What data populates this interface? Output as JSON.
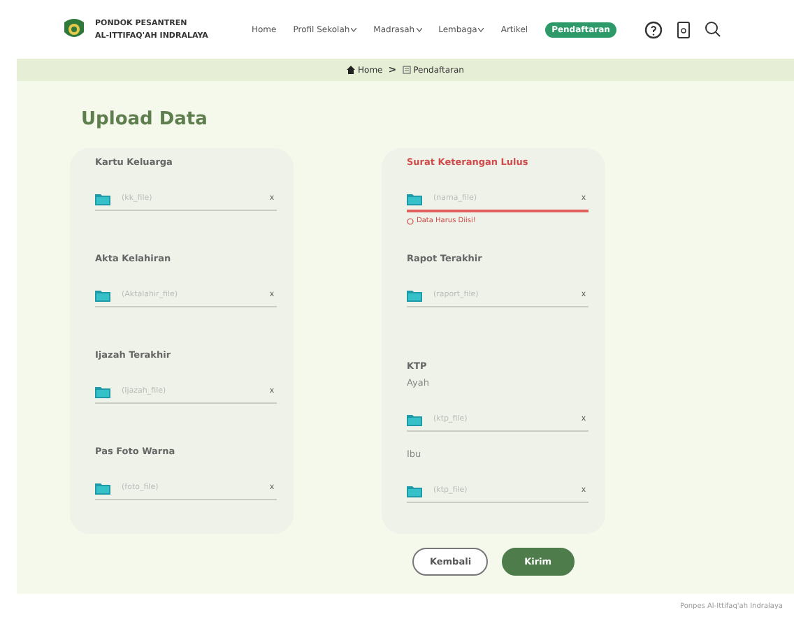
{
  "brand": {
    "line_1": "PONDOK PESANTREN",
    "line_2": "AL-ITTIFAQ'AH INDRALAYA"
  },
  "nav": [
    {
      "label": "Home",
      "has_menu": false,
      "selected": false
    },
    {
      "label": "Profil Sekolah",
      "has_menu": true,
      "selected": false
    },
    {
      "label": "Madrasah",
      "has_menu": true,
      "selected": false
    },
    {
      "label": "Lembaga",
      "has_menu": true,
      "selected": false
    },
    {
      "label": "Artikel",
      "has_menu": false,
      "selected": false
    },
    {
      "label": "Pendaftaran",
      "has_menu": false,
      "selected": true
    }
  ],
  "breadcrumb": [
    {
      "label": "Home",
      "kind": "home"
    },
    {
      "label": "Pendaftaran",
      "kind": "page"
    }
  ],
  "breadcrumb_separator": ">",
  "title": "Upload Data",
  "columns": [
    [
      {
        "kind": "upload",
        "label": "Kartu Keluarga",
        "placeholder": "(kk_file)",
        "clear": "x",
        "invalid": false
      },
      {
        "kind": "upload",
        "label": "Akta Kelahiran",
        "placeholder": "(Aktalahir_file)",
        "clear": "x",
        "invalid": false
      },
      {
        "kind": "upload",
        "label": "Ijazah Terakhir",
        "placeholder": "(Ijazah_file)",
        "clear": "x",
        "invalid": false
      },
      {
        "kind": "upload",
        "label": "Pas Foto Warna",
        "placeholder": "(foto_file)",
        "clear": "x",
        "invalid": false
      }
    ],
    [
      {
        "kind": "upload",
        "label": "Surat Keterangan Lulus",
        "placeholder": "(nama_file)",
        "clear": "x",
        "invalid": true,
        "error": "Data Harus Diisi!"
      },
      {
        "kind": "upload",
        "label": "Rapot Terakhir",
        "placeholder": "(raport_file)",
        "clear": "x",
        "invalid": false
      },
      {
        "kind": "group",
        "label": "KTP",
        "children": [
          {
            "kind": "upload",
            "label": "Ayah",
            "placeholder": "(ktp_file)",
            "clear": "x",
            "invalid": false
          },
          {
            "kind": "upload",
            "label": "Ibu",
            "placeholder": "(ktp_file)",
            "clear": "x",
            "invalid": false
          }
        ]
      }
    ]
  ],
  "buttons": [
    {
      "label": "Kembali",
      "kind": "outline"
    },
    {
      "label": "Kirim",
      "kind": "primary"
    }
  ],
  "footer": "Ponpes Al-Ittifaq'ah Indralaya"
}
